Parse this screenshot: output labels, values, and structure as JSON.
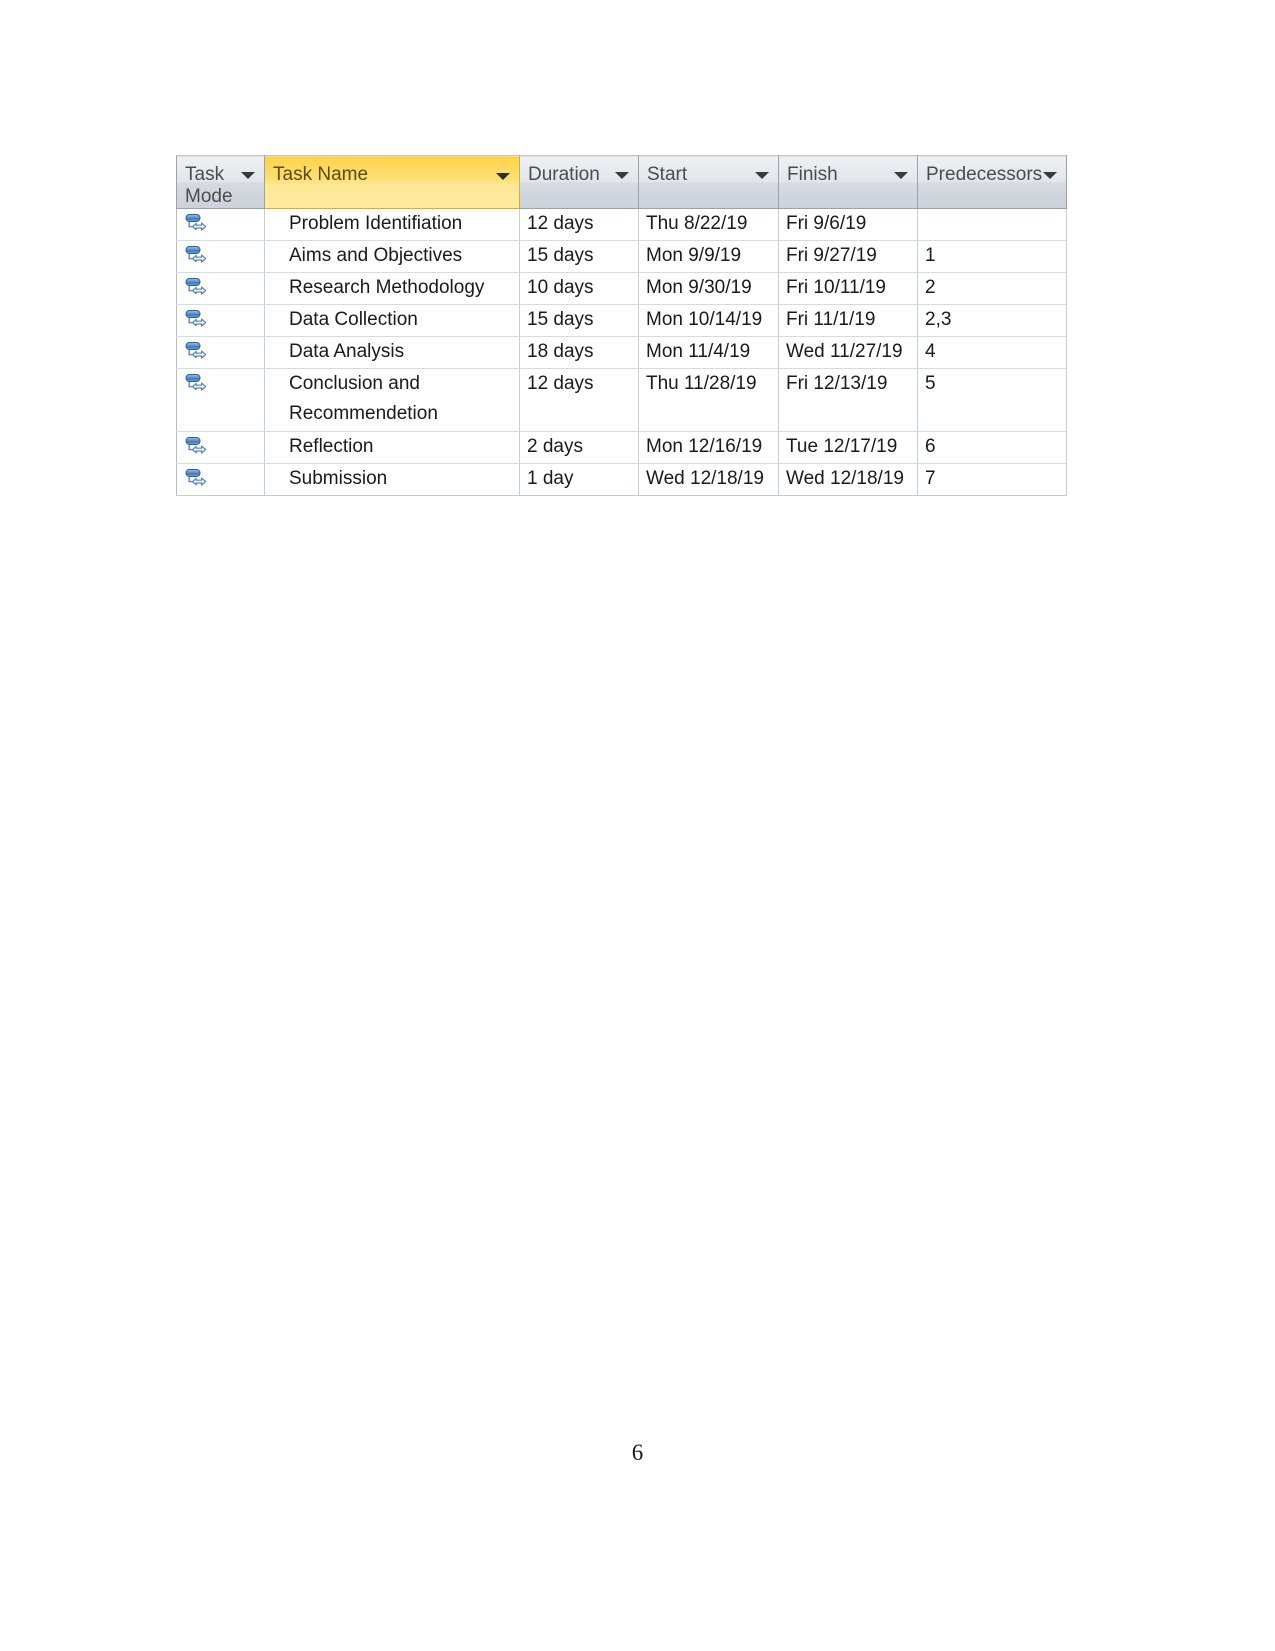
{
  "document": {
    "page_number": "6"
  },
  "table": {
    "columns": [
      {
        "key": "task_mode",
        "label": "Task\nMode",
        "has_filter_arrow": true,
        "highlighted": false
      },
      {
        "key": "task_name",
        "label": "Task Name",
        "has_filter_arrow": true,
        "highlighted": true
      },
      {
        "key": "duration",
        "label": "Duration",
        "has_filter_arrow": true,
        "highlighted": false
      },
      {
        "key": "start",
        "label": "Start",
        "has_filter_arrow": true,
        "highlighted": false
      },
      {
        "key": "finish",
        "label": "Finish",
        "has_filter_arrow": true,
        "highlighted": false
      },
      {
        "key": "predecessors",
        "label": "Predecessors",
        "has_filter_arrow": true,
        "highlighted": false
      }
    ],
    "header_colors": {
      "default_background": "#d5d9e0",
      "highlight_background": "#ffd45a",
      "header_text": "#4c4c4c",
      "highlight_text": "#5a4a14",
      "border": "#9aa1ab"
    },
    "row_icon": "manually-scheduled-task-icon",
    "rows": [
      {
        "task_mode": "manually-scheduled-task-icon",
        "task_name": "Problem Identifiation",
        "duration": "12 days",
        "start": "Thu 8/22/19",
        "finish": "Fri 9/6/19",
        "predecessors": ""
      },
      {
        "task_mode": "manually-scheduled-task-icon",
        "task_name": "Aims and Objectives",
        "duration": "15 days",
        "start": "Mon 9/9/19",
        "finish": "Fri 9/27/19",
        "predecessors": "1"
      },
      {
        "task_mode": "manually-scheduled-task-icon",
        "task_name": "Research Methodology",
        "duration": "10 days",
        "start": "Mon 9/30/19",
        "finish": "Fri 10/11/19",
        "predecessors": "2"
      },
      {
        "task_mode": "manually-scheduled-task-icon",
        "task_name": "Data Collection",
        "duration": "15 days",
        "start": "Mon 10/14/19",
        "finish": "Fri 11/1/19",
        "predecessors": "2,3"
      },
      {
        "task_mode": "manually-scheduled-task-icon",
        "task_name": "Data Analysis",
        "duration": "18 days",
        "start": "Mon 11/4/19",
        "finish": "Wed 11/27/19",
        "predecessors": "4"
      },
      {
        "task_mode": "manually-scheduled-task-icon",
        "task_name": "Conclusion and Recommendetion",
        "duration": "12 days",
        "start": "Thu 11/28/19",
        "finish": "Fri 12/13/19",
        "predecessors": "5"
      },
      {
        "task_mode": "manually-scheduled-task-icon",
        "task_name": "Reflection",
        "duration": "2 days",
        "start": "Mon 12/16/19",
        "finish": "Tue 12/17/19",
        "predecessors": "6"
      },
      {
        "task_mode": "manually-scheduled-task-icon",
        "task_name": "Submission",
        "duration": "1 day",
        "start": "Wed 12/18/19",
        "finish": "Wed 12/18/19",
        "predecessors": "7"
      }
    ]
  }
}
